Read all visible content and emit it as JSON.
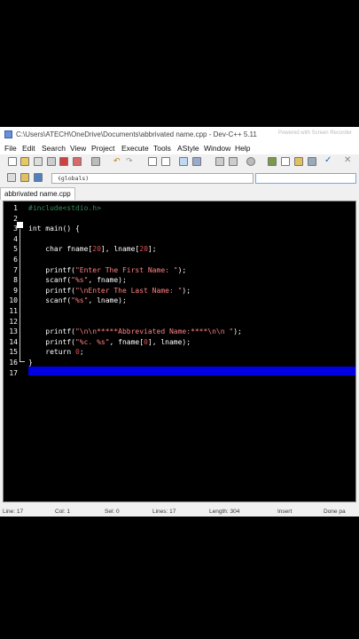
{
  "window": {
    "title": "C:\\Users\\ATECH\\OneDrive\\Documents\\abbrivated name.cpp - Dev-C++ 5.11",
    "watermark": "Powered with  Screen Recorder"
  },
  "menu": [
    "File",
    "Edit",
    "Search",
    "View",
    "Project",
    "Execute",
    "Tools",
    "AStyle",
    "Window",
    "Help"
  ],
  "scope_selector": {
    "value": "(globals)"
  },
  "tab": {
    "label": "abbrivated name.cpp"
  },
  "editor": {
    "lines": [
      {
        "n": "1",
        "segments": [
          {
            "t": "#include<stdio.h>",
            "c": "pp"
          }
        ]
      },
      {
        "n": "2",
        "segments": []
      },
      {
        "n": "3",
        "segments": [
          {
            "t": "int ",
            "c": "kw"
          },
          {
            "t": "main() {",
            "c": "pl"
          }
        ]
      },
      {
        "n": "4",
        "segments": []
      },
      {
        "n": "5",
        "segments": [
          {
            "t": "    char ",
            "c": "kw"
          },
          {
            "t": "fname[",
            "c": "pl"
          },
          {
            "t": "20",
            "c": "num"
          },
          {
            "t": "], lname[",
            "c": "pl"
          },
          {
            "t": "20",
            "c": "num"
          },
          {
            "t": "];",
            "c": "pl"
          }
        ]
      },
      {
        "n": "6",
        "segments": []
      },
      {
        "n": "7",
        "segments": [
          {
            "t": "    printf(",
            "c": "pl"
          },
          {
            "t": "\"Enter The First Name: \"",
            "c": "str"
          },
          {
            "t": ");",
            "c": "pl"
          }
        ]
      },
      {
        "n": "8",
        "segments": [
          {
            "t": "    scanf(",
            "c": "pl"
          },
          {
            "t": "\"%s\"",
            "c": "str"
          },
          {
            "t": ", fname);",
            "c": "pl"
          }
        ]
      },
      {
        "n": "9",
        "segments": [
          {
            "t": "    printf(",
            "c": "pl"
          },
          {
            "t": "\"\\nEnter The Last Name: \"",
            "c": "str"
          },
          {
            "t": ");",
            "c": "pl"
          }
        ]
      },
      {
        "n": "10",
        "segments": [
          {
            "t": "    scanf(",
            "c": "pl"
          },
          {
            "t": "\"%s\"",
            "c": "str"
          },
          {
            "t": ", lname);",
            "c": "pl"
          }
        ]
      },
      {
        "n": "11",
        "segments": []
      },
      {
        "n": "12",
        "segments": []
      },
      {
        "n": "13",
        "segments": [
          {
            "t": "    printf(",
            "c": "pl"
          },
          {
            "t": "\"\\n\\n*****Abbreviated Name:****\\n\\n \"",
            "c": "str"
          },
          {
            "t": ");",
            "c": "pl"
          }
        ]
      },
      {
        "n": "14",
        "segments": [
          {
            "t": "    printf(",
            "c": "pl"
          },
          {
            "t": "\"%c. %s\"",
            "c": "str"
          },
          {
            "t": ", fname[",
            "c": "pl"
          },
          {
            "t": "0",
            "c": "num"
          },
          {
            "t": "], lname);",
            "c": "pl"
          }
        ]
      },
      {
        "n": "15",
        "segments": [
          {
            "t": "    return ",
            "c": "kw"
          },
          {
            "t": "0",
            "c": "num"
          },
          {
            "t": ";",
            "c": "pl"
          }
        ]
      },
      {
        "n": "16",
        "segments": [
          {
            "t": "}",
            "c": "pl"
          }
        ]
      },
      {
        "n": "17",
        "segments": []
      }
    ]
  },
  "status": {
    "line": "Line:  17",
    "col": "Col:  1",
    "sel": "Sel:  0",
    "lines": "Lines:  17",
    "length": "Length:  304",
    "mode": "Insert",
    "message": "Done pa"
  },
  "colors": {
    "current_line": "#0000e0",
    "string": "#ff8080",
    "number": "#e05050",
    "preprocessor": "#2e8b57"
  }
}
